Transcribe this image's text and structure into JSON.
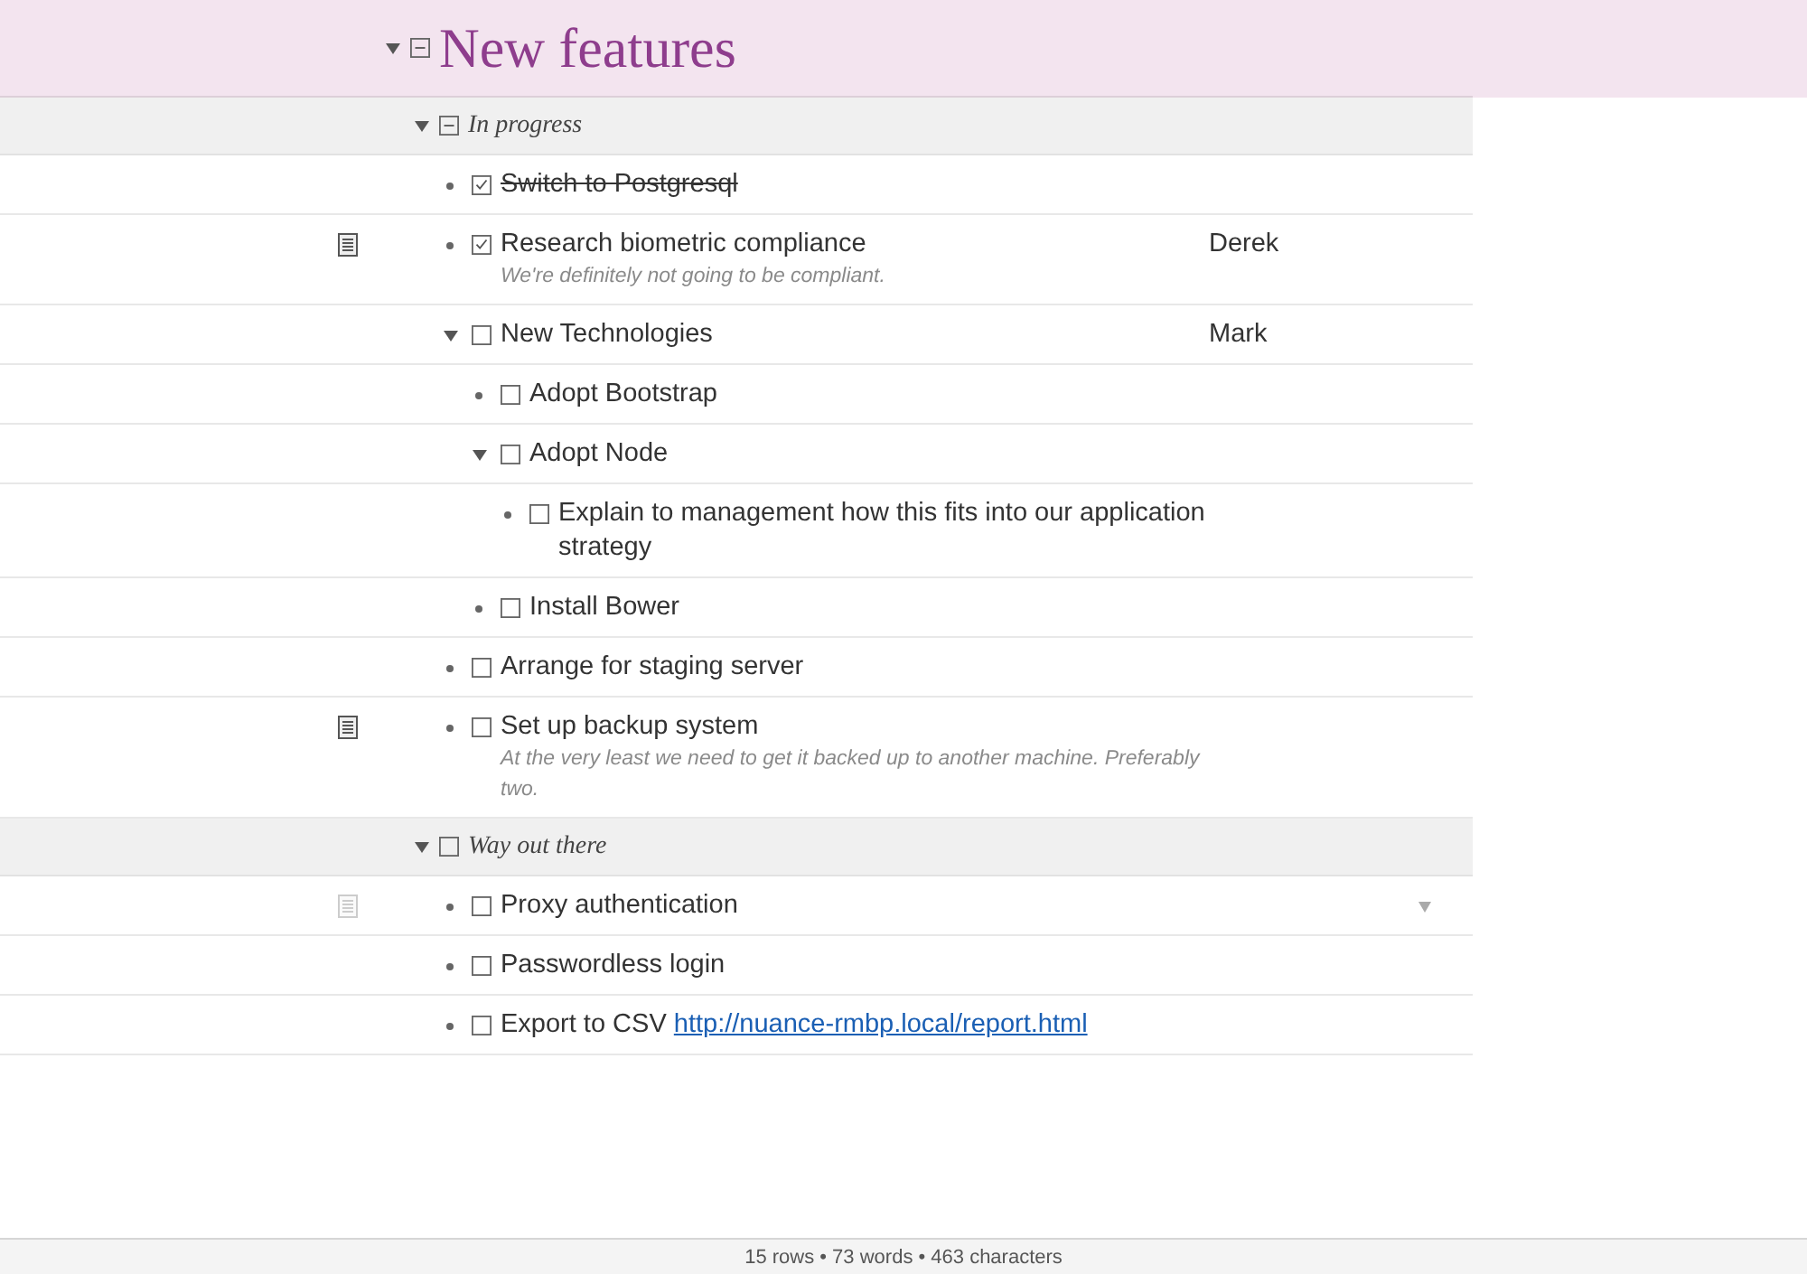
{
  "title": {
    "text": "New features",
    "expanded": true,
    "checked": false,
    "mixed": true
  },
  "sections": [
    {
      "label": "In progress",
      "expanded": true,
      "checked": false,
      "mixed": true,
      "rows": [
        {
          "text": "Switch to Postgresql",
          "checked": true,
          "done": true
        },
        {
          "text": "Research biometric compliance",
          "checked": true,
          "done": false,
          "note": "We're definitely not going to be compliant.",
          "assignee": "Derek"
        },
        {
          "text": "New Technologies",
          "checked": false,
          "done": false,
          "assignee": "Mark",
          "expanded": true,
          "children": [
            {
              "text": "Adopt Bootstrap",
              "checked": false,
              "done": false
            },
            {
              "text": "Adopt Node",
              "checked": false,
              "done": false,
              "expanded": true,
              "children": [
                {
                  "text": "Explain to management how this fits into our application strategy",
                  "checked": false,
                  "done": false
                }
              ]
            },
            {
              "text": "Install Bower",
              "checked": false,
              "done": false
            }
          ]
        },
        {
          "text": "Arrange for staging server",
          "checked": false,
          "done": false
        },
        {
          "text": "Set up backup system",
          "checked": false,
          "done": false,
          "note": "At the very least we need to get it backed up to another machine. Preferably two."
        }
      ]
    },
    {
      "label": "Way out there",
      "expanded": true,
      "checked": false,
      "rows": [
        {
          "text": "Proxy authentication",
          "checked": false,
          "done": false,
          "hovered": true
        },
        {
          "text": "Passwordless login",
          "checked": false,
          "done": false
        },
        {
          "text": "Export to CSV",
          "checked": false,
          "done": false,
          "link": "http://nuance-rmbp.local/report.html"
        }
      ]
    }
  ],
  "status_bar": "15 rows • 73 words • 463 characters"
}
